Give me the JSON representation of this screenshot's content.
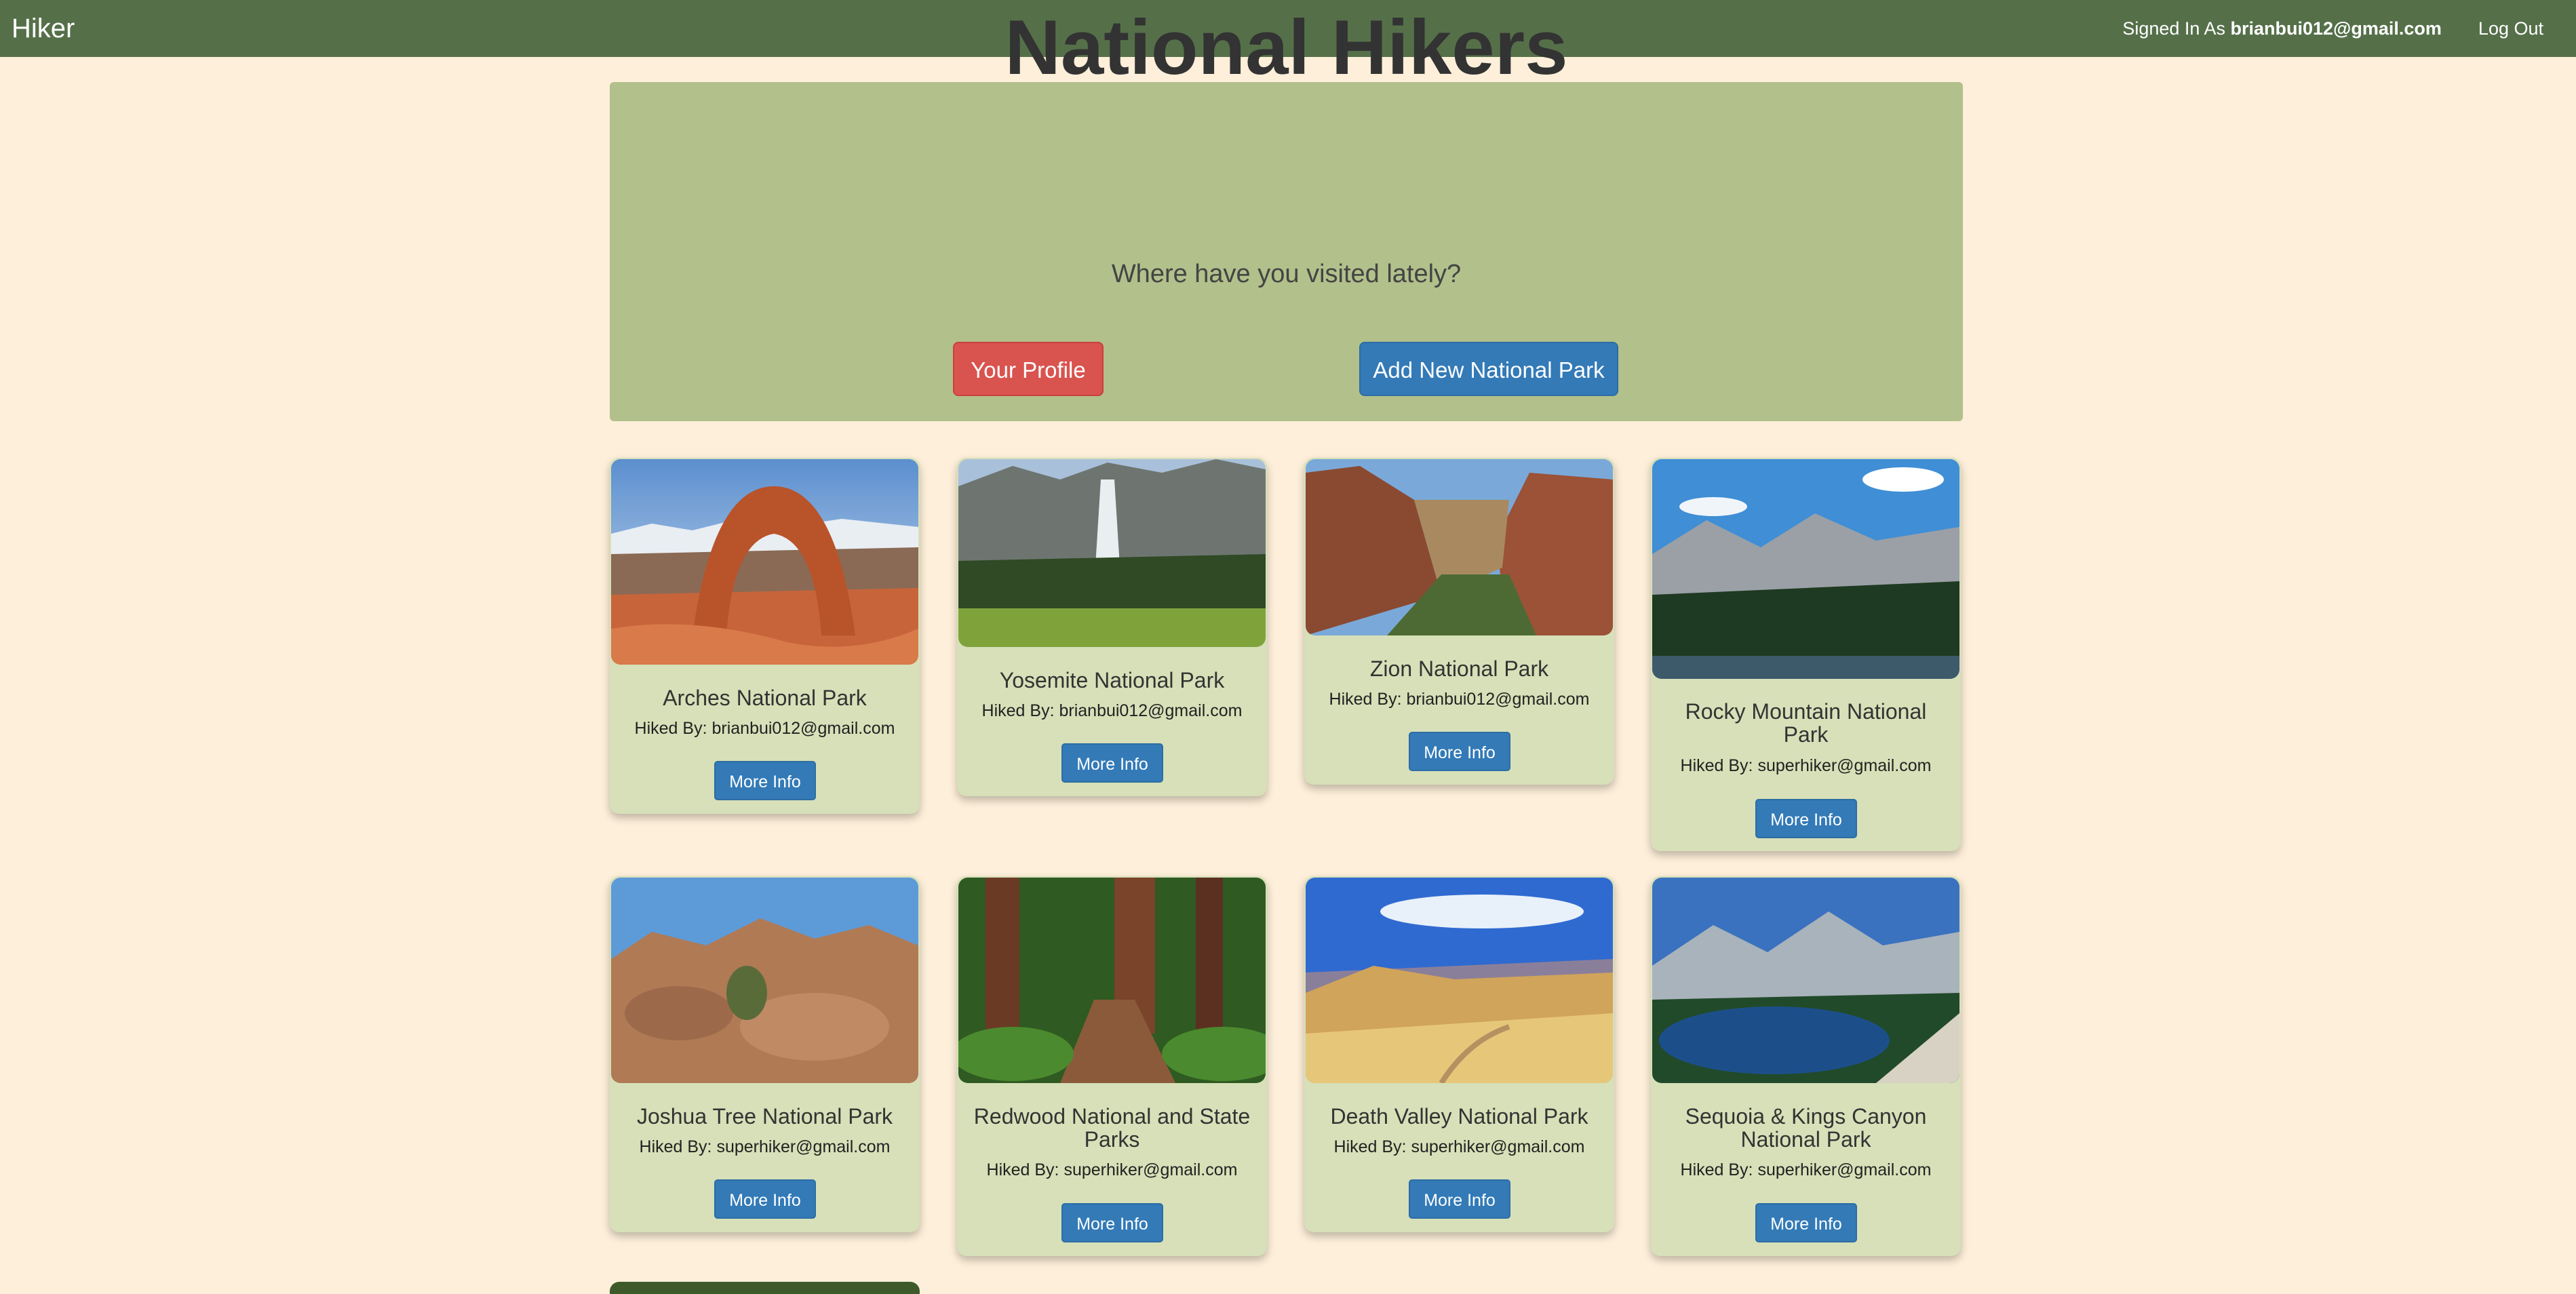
{
  "navbar": {
    "brand": "Hiker",
    "signed_in_prefix": "Signed In As",
    "signed_in_user": "brianbui012@gmail.com",
    "logout_label": "Log Out"
  },
  "hero": {
    "title": "National Hikers",
    "subtitle": "Where have you visited lately?",
    "profile_button": "Your Profile",
    "add_park_button": "Add New National Park"
  },
  "parks": [
    {
      "name": "Arches National Park",
      "hiked_by": "Hiked By: brianbui012@gmail.com",
      "button": "More Info",
      "image": "arches-photo"
    },
    {
      "name": "Yosemite National Park",
      "hiked_by": "Hiked By: brianbui012@gmail.com",
      "button": "More Info",
      "image": "yosemite-photo"
    },
    {
      "name": "Zion National Park",
      "hiked_by": "Hiked By: brianbui012@gmail.com",
      "button": "More Info",
      "image": "zion-photo"
    },
    {
      "name": "Rocky Mountain National Park",
      "hiked_by": "Hiked By: superhiker@gmail.com",
      "button": "More Info",
      "image": "rocky-mountain-photo"
    },
    {
      "name": "Joshua Tree National Park",
      "hiked_by": "Hiked By: superhiker@gmail.com",
      "button": "More Info",
      "image": "joshua-tree-photo"
    },
    {
      "name": "Redwood National and State Parks",
      "hiked_by": "Hiked By: superhiker@gmail.com",
      "button": "More Info",
      "image": "redwood-photo"
    },
    {
      "name": "Death Valley National Park",
      "hiked_by": "Hiked By: superhiker@gmail.com",
      "button": "More Info",
      "image": "death-valley-photo"
    },
    {
      "name": "Sequoia & Kings Canyon National Park",
      "hiked_by": "Hiked By: superhiker@gmail.com",
      "button": "More Info",
      "image": "sequoia-photo"
    }
  ],
  "colors": {
    "navbar": "#557049",
    "page_background": "#fdefd9",
    "hero_background": "#b2c08b",
    "card_background": "#d7e0b8",
    "primary_button": "#337ab7",
    "danger_button": "#d9534f"
  }
}
